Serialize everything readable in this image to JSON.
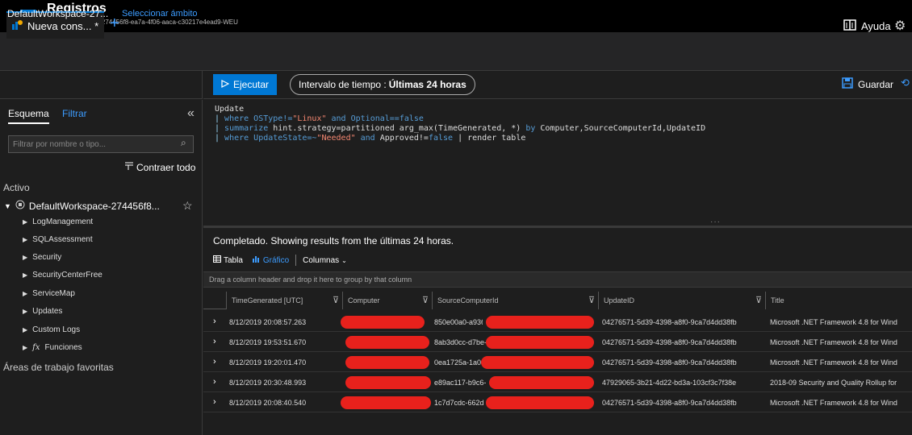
{
  "window": {
    "title": "Registros",
    "subtitle": "DefaultWorkspace-274456f8-ea7a-4f06-aaca-c30217e4ead9-WEU"
  },
  "tabs": {
    "active_label": "Nueva cons... *",
    "add_symbol": "+",
    "help_label": "Ayuda"
  },
  "scope": {
    "workspace": "DefaultWorkspace-27...",
    "select_link": "Seleccionar ámbito"
  },
  "toolbar": {
    "run_label": "Ejecutar",
    "time_range_prefix": "Intervalo de tiempo :",
    "time_range_value": "Últimas 24 horas",
    "save_label": "Guardar"
  },
  "sidebar": {
    "tab_schema": "Esquema",
    "tab_filter": "Filtrar",
    "collapse_symbol": "«",
    "filter_placeholder": "Filtrar por nombre o tipo...",
    "collapse_all": "Contraer todo",
    "active_heading": "Activo",
    "workspace_label": "DefaultWorkspace-274456f8...",
    "items": [
      {
        "label": "LogManagement"
      },
      {
        "label": "SQLAssessment"
      },
      {
        "label": "Security"
      },
      {
        "label": "SecurityCenterFree"
      },
      {
        "label": "ServiceMap"
      },
      {
        "label": "Updates"
      },
      {
        "label": "Custom Logs"
      },
      {
        "label": "Funciones"
      }
    ],
    "favorites_heading": "Áreas de trabajo favoritas"
  },
  "editor": {
    "line1": "Update",
    "line2_pipe": "| ",
    "line2_kw1": "where",
    "line2_a": " OSType!=",
    "line2_str": "\"Linux\"",
    "line2_kw2": " and",
    "line2_b": " Optional==",
    "line2_kw3": "false",
    "line3_kw": "summarize",
    "line3_a": " hint.strategy=partitioned arg_max(TimeGenerated, *) ",
    "line3_kw2": "by",
    "line3_b": " Computer,SourceComputerId,UpdateID",
    "line4_kw": "where",
    "line4_a": " UpdateState=~",
    "line4_str": "\"Needed\"",
    "line4_kw2": " and",
    "line4_b": " Approved!=",
    "line4_kw3": "false",
    "line4_c": " | ",
    "line4_d": "render table"
  },
  "results": {
    "status": "Completado. Showing results from the últimas 24 horas.",
    "view_table": "Tabla",
    "view_chart": "Gráfico",
    "view_columns": "Columnas",
    "group_hint": "Drag a column header and drop it here to group by that column",
    "columns": [
      "TimeGenerated [UTC]",
      "Computer",
      "SourceComputerId",
      "UpdateID",
      "Title"
    ],
    "rows": [
      {
        "time": "8/12/2019 20:08:57.263",
        "source": "850e00a0-a936",
        "update": "04276571-5d39-4398-a8f0-9ca7d4dd38fb",
        "title": "Microsoft .NET Framework 4.8 for Wind"
      },
      {
        "time": "8/12/2019 19:53:51.670",
        "source": "8ab3d0cc-d7be-",
        "update": "04276571-5d39-4398-a8f0-9ca7d4dd38fb",
        "title": "Microsoft .NET Framework 4.8 for Wind"
      },
      {
        "time": "8/12/2019 19:20:01.470",
        "source": "0ea1725a-1a0e",
        "update": "04276571-5d39-4398-a8f0-9ca7d4dd38fb",
        "title": "Microsoft .NET Framework 4.8 for Wind"
      },
      {
        "time": "8/12/2019 20:30:48.993",
        "source": "e89ac117-b9c6-",
        "update": "47929065-3b21-4d22-bd3a-103cf3c7f38e",
        "title": "2018-09 Security and Quality Rollup for"
      },
      {
        "time": "8/12/2019 20:08:40.540",
        "source": "1c7d7cdc-662d",
        "update": "04276571-5d39-4398-a8f0-9ca7d4dd38fb",
        "title": "Microsoft .NET Framework 4.8 for Wind"
      }
    ]
  },
  "colors": {
    "accent": "#0078d4",
    "link": "#3c9cff",
    "redaction": "#e8211c"
  },
  "icons": [
    "logs-logo-icon",
    "query-tab-icon",
    "book-icon",
    "gear-icon",
    "play-icon",
    "save-icon",
    "share-icon",
    "search-icon",
    "collapse-all-icon",
    "workspace-icon",
    "star-icon",
    "table-icon",
    "chart-icon",
    "filter-icon",
    "expand-chevron-icon",
    "function-icon"
  ]
}
